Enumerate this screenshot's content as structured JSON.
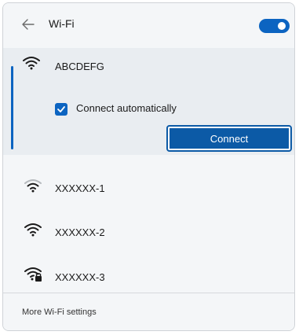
{
  "header": {
    "back_icon": "back-arrow-icon",
    "title": "Wi-Fi",
    "toggle_on": true
  },
  "networks": [
    {
      "name": "ABCDEFG",
      "icon": "wifi-full-icon",
      "expanded": true
    },
    {
      "name": "XXXXXX-1",
      "icon": "wifi-medium-icon"
    },
    {
      "name": "XXXXXX-2",
      "icon": "wifi-full-icon"
    },
    {
      "name": "XXXXXX-3",
      "icon": "wifi-secured-icon"
    }
  ],
  "expanded": {
    "auto_connect_label": "Connect automatically",
    "auto_connect_checked": true,
    "connect_label": "Connect"
  },
  "footer": {
    "link_label": "More Wi-Fi settings"
  },
  "colors": {
    "accent": "#0c64c1",
    "panel_bg": "#f4f6f8",
    "selected_bg": "#e9edf1"
  }
}
